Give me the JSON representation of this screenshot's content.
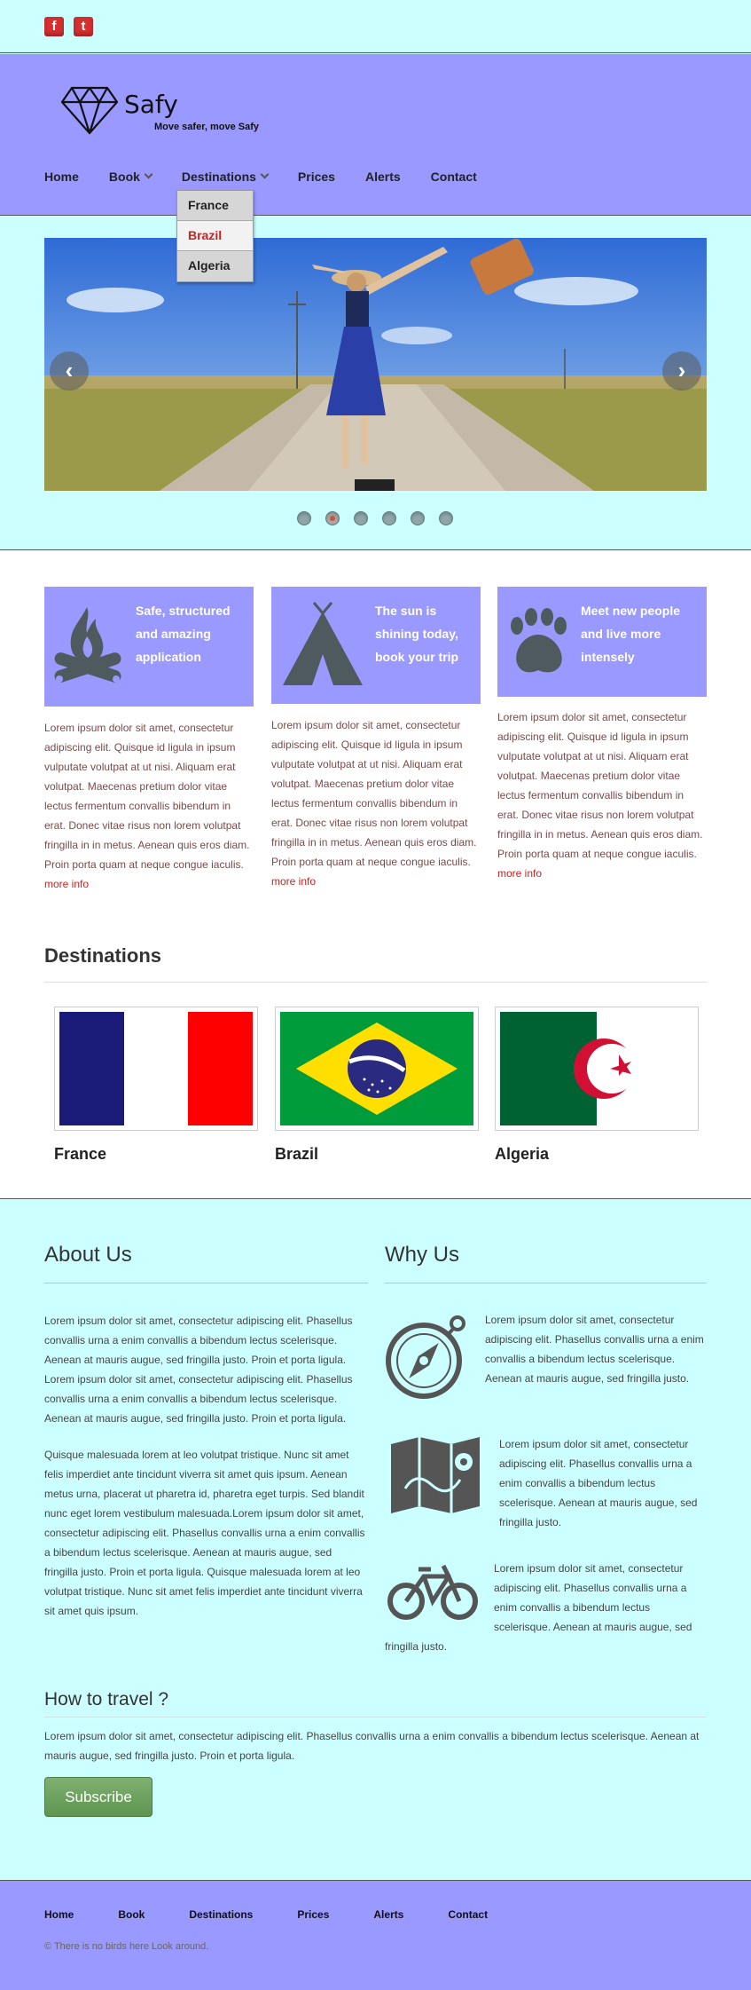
{
  "topbar": {
    "social": [
      "f",
      "t"
    ]
  },
  "logo": {
    "name": "Safy",
    "tagline": "Move safer, move Safy"
  },
  "nav": {
    "items": [
      "Home",
      "Book",
      "Destinations",
      "Prices",
      "Alerts",
      "Contact"
    ]
  },
  "dropdown": {
    "items": [
      "France",
      "Brazil",
      "Algeria"
    ],
    "hover_index": 1
  },
  "slider": {
    "prev": "‹",
    "next": "›",
    "slide_count": 6,
    "active_index": 1
  },
  "features": [
    {
      "title": "Safe, structured and amazing application",
      "icon": "campfire-icon",
      "text": "Lorem ipsum dolor sit amet, consectetur adipiscing elit. Quisque id ligula in ipsum vulputate volutpat at ut nisi. Aliquam erat volutpat. Maecenas pretium dolor vitae lectus fermentum convallis bibendum in erat. Donec vitae risus non lorem volutpat fringilla in in metus. Aenean quis eros diam. Proin porta quam at neque congue iaculis.",
      "more": "more info"
    },
    {
      "title": "The sun is shining today, book your trip",
      "icon": "tent-icon",
      "text": "Lorem ipsum dolor sit amet, consectetur adipiscing elit. Quisque id ligula in ipsum vulputate volutpat at ut nisi. Aliquam erat volutpat. Maecenas pretium dolor vitae lectus fermentum convallis bibendum in erat. Donec vitae risus non lorem volutpat fringilla in in metus. Aenean quis eros diam. Proin porta quam at neque congue iaculis.",
      "more": "more info"
    },
    {
      "title": "Meet new people and live more intensely",
      "icon": "paw-icon",
      "text": "Lorem ipsum dolor sit amet, consectetur adipiscing elit. Quisque id ligula in ipsum vulputate volutpat at ut nisi. Aliquam erat volutpat. Maecenas pretium dolor vitae lectus fermentum convallis bibendum in erat. Donec vitae risus non lorem volutpat fringilla in in metus. Aenean quis eros diam. Proin porta quam at neque congue iaculis.",
      "more": "more info"
    }
  ],
  "destinations": {
    "title": "Destinations",
    "items": [
      "France",
      "Brazil",
      "Algeria"
    ],
    "colors": {
      "france_blue": "#1b1b7a",
      "france_red": "#ff0000",
      "brazil_green": "#009c3b",
      "brazil_yellow": "#fedf00",
      "brazil_blue": "#2a2a80",
      "algeria_green": "#006233",
      "algeria_red": "#d21034"
    }
  },
  "about": {
    "title": "About Us",
    "p1": "Lorem ipsum dolor sit amet, consectetur adipiscing elit. Phasellus convallis urna a enim convallis a bibendum lectus scelerisque. Aenean at mauris augue, sed fringilla justo. Proin et porta ligula. Lorem ipsum dolor sit amet, consectetur adipiscing elit. Phasellus convallis urna a enim convallis a bibendum lectus scelerisque. Aenean at mauris augue, sed fringilla justo. Proin et porta ligula.",
    "p2": "Quisque malesuada lorem at leo volutpat tristique. Nunc sit amet felis imperdiet ante tincidunt viverra sit amet quis ipsum. Aenean metus urna, placerat ut pharetra id, pharetra eget turpis. Sed blandit nunc eget lorem vestibulum malesuada.Lorem ipsum dolor sit amet, consectetur adipiscing elit. Phasellus convallis urna a enim convallis a bibendum lectus scelerisque. Aenean at mauris augue, sed fringilla justo. Proin et porta ligula. Quisque malesuada lorem at leo volutpat tristique. Nunc sit amet felis imperdiet ante tincidunt viverra sit amet quis ipsum."
  },
  "why": {
    "title": "Why Us",
    "items": [
      {
        "icon": "compass-icon",
        "text": "Lorem ipsum dolor sit amet, consectetur adipiscing elit. Phasellus convallis urna a enim convallis a bibendum lectus scelerisque. Aenean at mauris augue, sed fringilla justo."
      },
      {
        "icon": "map-icon",
        "text": "Lorem ipsum dolor sit amet, consectetur adipiscing elit. Phasellus convallis urna a enim convallis a bibendum lectus scelerisque. Aenean at mauris augue, sed fringilla justo."
      },
      {
        "icon": "bicycle-icon",
        "text": "Lorem ipsum dolor sit amet, consectetur adipiscing elit. Phasellus convallis urna a enim convallis a bibendum lectus scelerisque. Aenean at mauris augue, sed",
        "text_tail": "fringilla justo."
      }
    ]
  },
  "travel": {
    "title": "How to travel ?",
    "text": "Lorem ipsum dolor sit amet, consectetur adipiscing elit. Phasellus convallis urna a enim convallis a bibendum lectus scelerisque. Aenean at mauris augue, sed fringilla justo. Proin et porta ligula.",
    "button": "Subscribe"
  },
  "footer": {
    "nav": [
      "Home",
      "Book",
      "Destinations",
      "Prices",
      "Alerts",
      "Contact"
    ],
    "copyright": "© There is no birds here   Look around."
  }
}
